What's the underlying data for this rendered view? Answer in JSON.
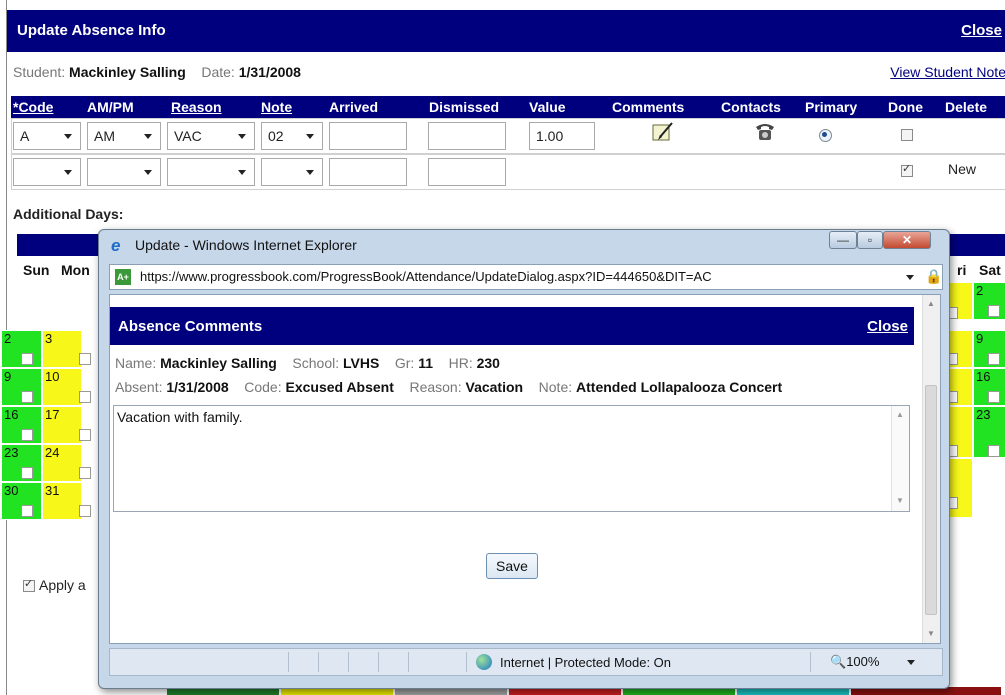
{
  "outer": {
    "title": "Update Absence Info",
    "close": "Close",
    "student_label": "Student:",
    "student_name": "Mackinley Salling",
    "date_label": "Date:",
    "date_value": "1/31/2008",
    "view_notes": "View Student Note"
  },
  "grid": {
    "headers": [
      "*Code",
      "AM/PM",
      "Reason",
      "Note",
      "Arrived",
      "Dismissed",
      "Value",
      "Comments",
      "Contacts",
      "Primary",
      "Done",
      "Delete"
    ],
    "row1": {
      "code": "A",
      "ampm": "AM",
      "reason": "VAC",
      "note": "02",
      "arrived": "",
      "dismissed": "",
      "value": "1.00"
    },
    "row2": {
      "code": "",
      "ampm": "",
      "reason": "",
      "note": "",
      "status": "New"
    }
  },
  "additional": {
    "label": "Additional Days:",
    "days": [
      "Sun",
      "Mon",
      "ri",
      "Sat"
    ],
    "left_numbers": [
      [
        "2",
        "3"
      ],
      [
        "9",
        "10"
      ],
      [
        "16",
        "17"
      ],
      [
        "23",
        "24"
      ],
      [
        "30",
        "31"
      ]
    ],
    "right_numbers": [
      "2",
      "9",
      "16",
      "23"
    ],
    "apply_text": "Apply a"
  },
  "popup": {
    "window_title": "Update - Windows Internet Explorer",
    "url": "https://www.progressbook.com/ProgressBook/Attendance/UpdateDialog.aspx?ID=444650&DIT=AC",
    "header": "Absence Comments",
    "close": "Close",
    "name_label": "Name:",
    "name": "Mackinley Salling",
    "school_label": "School:",
    "school": "LVHS",
    "gr_label": "Gr:",
    "gr": "11",
    "hr_label": "HR:",
    "hr": "230",
    "absent_label": "Absent:",
    "absent": "1/31/2008",
    "code_label": "Code:",
    "code": "Excused Absent",
    "reason_label": "Reason:",
    "reason": "Vacation",
    "note_label": "Note:",
    "note": "Attended Lollapalooza Concert",
    "comment": "Vacation with family.",
    "save": "Save",
    "status_zone": "Internet | Protected Mode: On",
    "zoom": "100%"
  },
  "colors": {
    "navy": "#00007f",
    "green": "#22e322",
    "yellow": "#f7f71a"
  }
}
